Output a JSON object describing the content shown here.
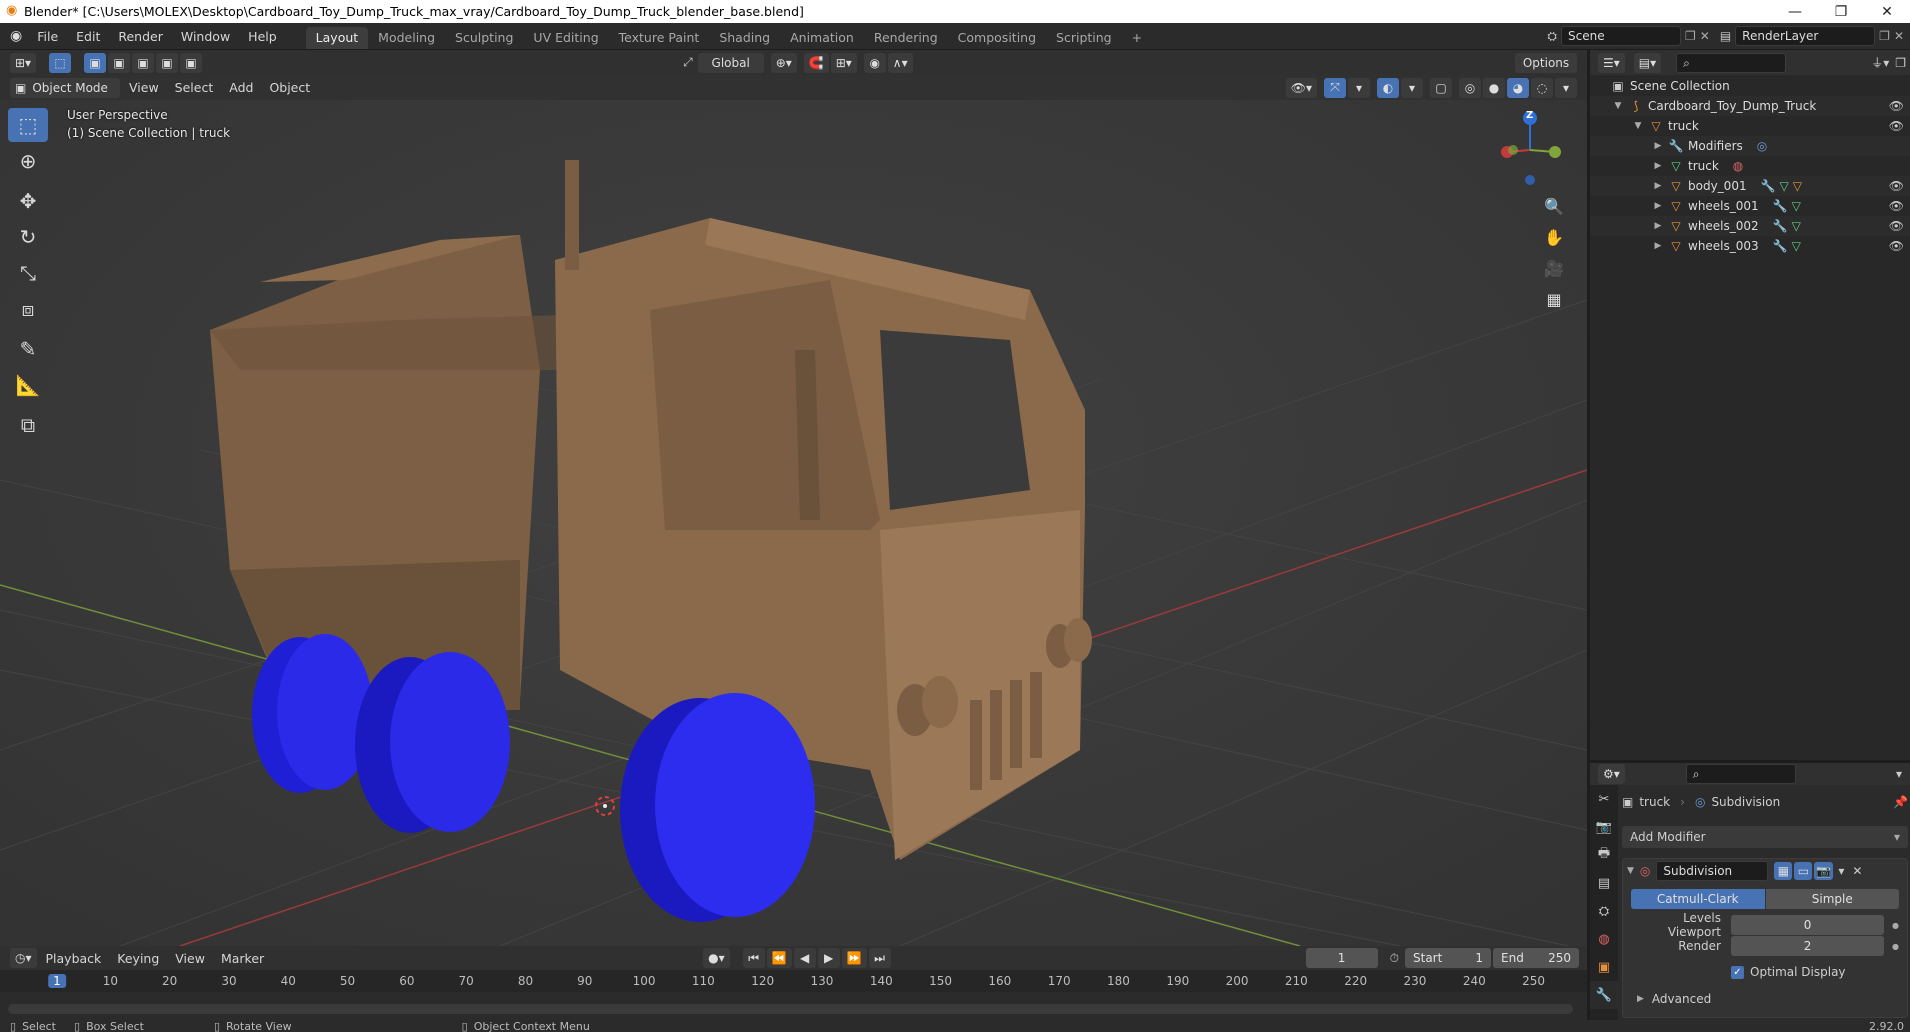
{
  "window": {
    "title": "Blender* [C:\\Users\\MOLEX\\Desktop\\Cardboard_Toy_Dump_Truck_max_vray/Cardboard_Toy_Dump_Truck_blender_base.blend]",
    "minimize": "—",
    "restore": "❐",
    "close": "✕"
  },
  "menu": [
    "File",
    "Edit",
    "Render",
    "Window",
    "Help"
  ],
  "workspaces": [
    "Layout",
    "Modeling",
    "Sculpting",
    "UV Editing",
    "Texture Paint",
    "Shading",
    "Animation",
    "Rendering",
    "Compositing",
    "Scripting"
  ],
  "workspace_add": "+",
  "scene": {
    "name": "Scene",
    "render_layer": "RenderLayer"
  },
  "viewport_header": {
    "transform_orientation": "Global",
    "options": "Options",
    "mode": "Object Mode",
    "menus": [
      "View",
      "Select",
      "Add",
      "Object"
    ]
  },
  "viewport": {
    "perspective": "User Perspective",
    "collection": "(1) Scene Collection | truck",
    "gizmo": {
      "z": "Z"
    }
  },
  "outliner": {
    "rows": [
      {
        "label": "Scene Collection",
        "icon": "scene-collection-icon"
      },
      {
        "label": "Cardboard_Toy_Dump_Truck",
        "icon": "armature-icon"
      },
      {
        "label": "truck",
        "icon": "object-icon"
      },
      {
        "label": "Modifiers",
        "icon": "wrench-icon"
      },
      {
        "label": "truck",
        "icon": "mesh-icon"
      },
      {
        "label": "body_001",
        "icon": "object-icon"
      },
      {
        "label": "wheels_001",
        "icon": "object-icon"
      },
      {
        "label": "wheels_002",
        "icon": "object-icon"
      },
      {
        "label": "wheels_003",
        "icon": "object-icon"
      }
    ]
  },
  "properties": {
    "object_name": "truck",
    "modifier_name": "Subdivision",
    "add_modifier": "Add Modifier",
    "modifier_panel_name": "Subdivision",
    "algorithm": {
      "options": [
        "Catmull-Clark",
        "Simple"
      ],
      "selected": "Catmull-Clark"
    },
    "levels_viewport": {
      "label": "Levels Viewport",
      "value": "0"
    },
    "render": {
      "label": "Render",
      "value": "2"
    },
    "optimal_display": {
      "label": "Optimal Display",
      "checked": true
    },
    "advanced": "Advanced"
  },
  "timeline": {
    "menus": [
      "Playback",
      "Keying",
      "View",
      "Marker"
    ],
    "current_frame": "1",
    "start_label": "Start",
    "start": "1",
    "end_label": "End",
    "end": "250",
    "ruler": [
      "1",
      "10",
      "20",
      "30",
      "40",
      "50",
      "60",
      "70",
      "80",
      "90",
      "100",
      "110",
      "120",
      "130",
      "140",
      "150",
      "160",
      "170",
      "180",
      "190",
      "200",
      "210",
      "220",
      "230",
      "240",
      "250"
    ]
  },
  "statusbar": {
    "select": "Select",
    "box_select": "Box Select",
    "rotate_view": "Rotate View",
    "context_menu": "Object Context Menu",
    "version": "2.92.0"
  },
  "colors": {
    "accent": "#4772b3",
    "cardboard": "#8a6a4a",
    "wheel": "#1f1fd6",
    "x_axis": "#c23b3b",
    "y_axis": "#7fa63a",
    "z_axis": "#2e6fd8"
  }
}
